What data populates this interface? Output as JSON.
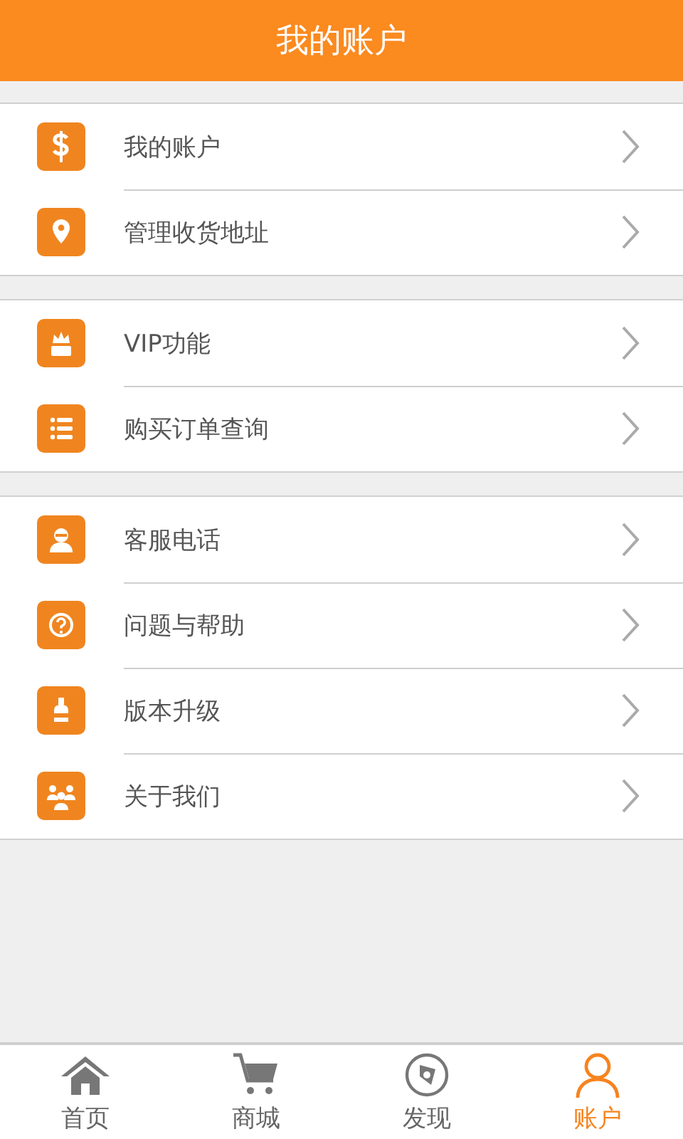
{
  "header": {
    "title": "我的账户"
  },
  "sections": [
    {
      "items": [
        {
          "label": "我的账户"
        },
        {
          "label": "管理收货地址"
        }
      ]
    },
    {
      "items": [
        {
          "label": "VIP功能"
        },
        {
          "label": "购买订单查询"
        }
      ]
    },
    {
      "items": [
        {
          "label": "客服电话"
        },
        {
          "label": "问题与帮助"
        },
        {
          "label": "版本升级"
        },
        {
          "label": "关于我们"
        }
      ]
    }
  ],
  "tab_bar": [
    {
      "label": "首页",
      "selected": false
    },
    {
      "label": "商城",
      "selected": false
    },
    {
      "label": "发现",
      "selected": false
    },
    {
      "label": "账户",
      "selected": true
    }
  ]
}
